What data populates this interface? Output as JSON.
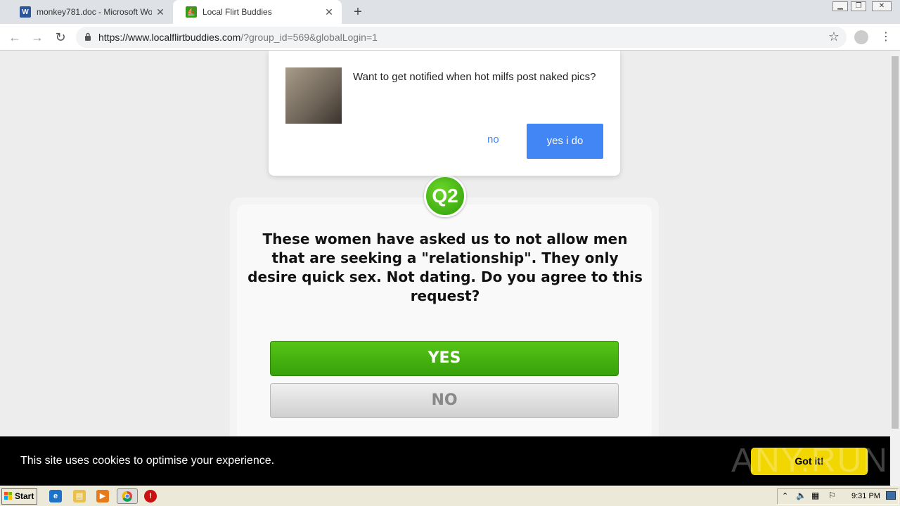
{
  "browser": {
    "tabs": [
      {
        "label": "monkey781.doc - Microsoft Word Onl",
        "icon": "word-icon",
        "active": false
      },
      {
        "label": "Local Flirt Buddies",
        "icon": "site-favicon",
        "active": true
      }
    ],
    "new_tab": "+",
    "address": {
      "host": "https://www.localflirtbuddies.com",
      "path": "/?group_id=569&globalLogin=1"
    }
  },
  "notification": {
    "message": "Want to get notified when hot milfs post naked pics?",
    "no_label": "no",
    "yes_label": "yes i do"
  },
  "quiz": {
    "badge": "Q2",
    "question": "These women have asked us to not allow men that are seeking a \"relationship\". They only desire quick sex. Not dating. Do you agree to this request?",
    "yes_label": "YES",
    "no_label": "NO"
  },
  "cookie": {
    "message": "This site uses cookies to optimise your experience.",
    "button_label": "Got it!"
  },
  "watermark": "ANY.RUN",
  "taskbar": {
    "start_label": "Start",
    "clock": "9:31 PM"
  },
  "colors": {
    "green": "#3aa60c",
    "blue": "#4285f4",
    "cookie_button": "#f1d600"
  }
}
